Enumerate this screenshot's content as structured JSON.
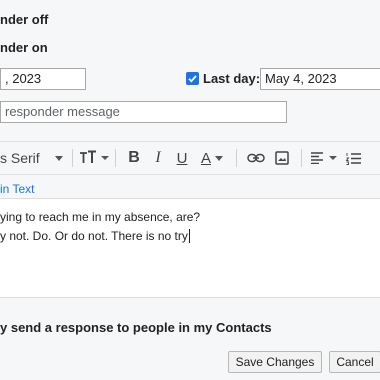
{
  "responder": {
    "off_label": "nder off",
    "on_label": "nder on"
  },
  "dates": {
    "first_day_value": ", 2023",
    "last_day_label": "Last day:",
    "last_day_value": "May 4, 2023",
    "last_day_checked": true
  },
  "subject": {
    "value": " responder message"
  },
  "toolbar": {
    "font": "s Serif",
    "size_icon": "text-size-icon",
    "bold": "B",
    "italic": "I",
    "underline": "U",
    "text_color": "A",
    "link_icon": "link-icon",
    "image_icon": "image-icon",
    "align_icon": "align-icon",
    "numbered_list_icon": "numbered-list-icon"
  },
  "editor": {
    "plain_text_link": "in Text",
    "line1": "ying to reach me in my absence, are?",
    "line2": "y not. Do. Or do not. There is no try"
  },
  "contacts_option": {
    "label": "y send a response to people in my Contacts"
  },
  "buttons": {
    "save": "Save Changes",
    "cancel": "Cancel"
  },
  "colors": {
    "link": "#1a73e8",
    "checkbox": "#1a73e8"
  }
}
